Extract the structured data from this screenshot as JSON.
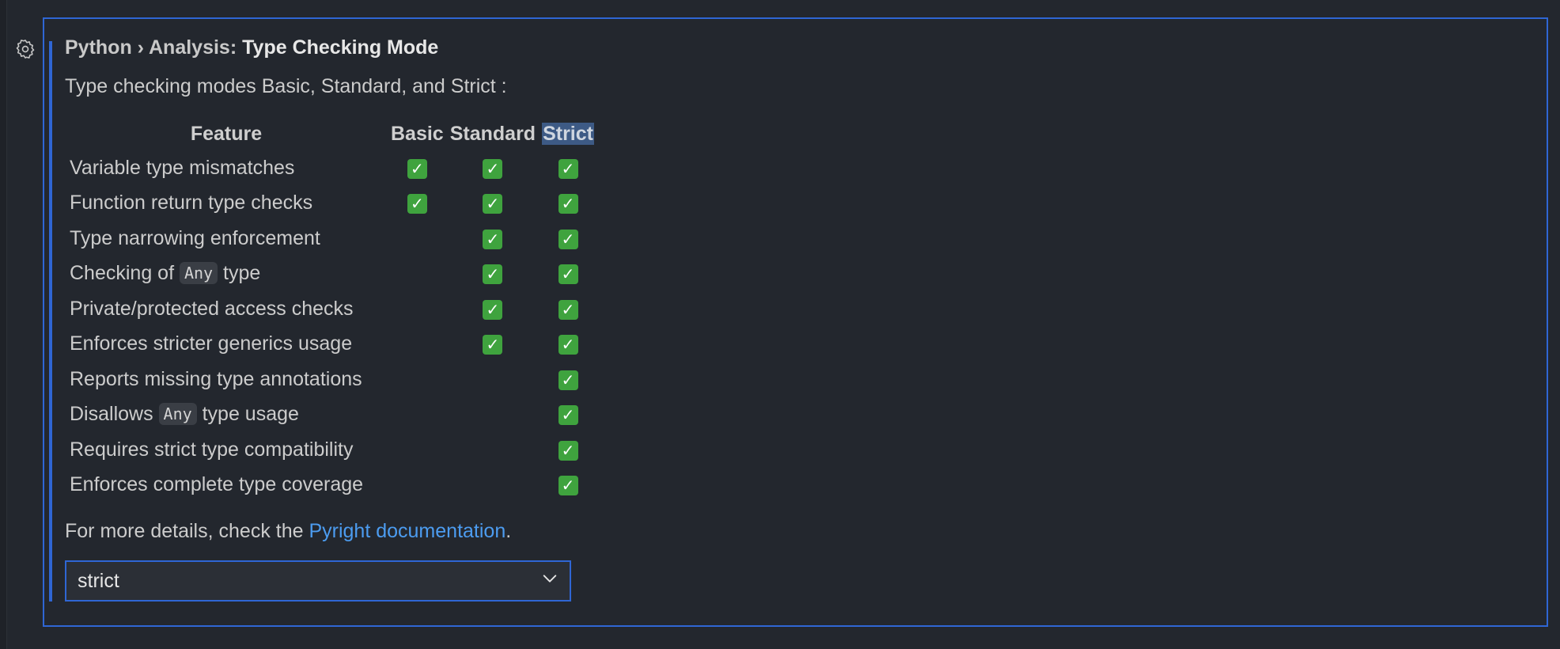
{
  "setting": {
    "category": "Python › Analysis:",
    "name": "Type Checking Mode",
    "description": "Type checking modes Basic, Standard, and Strict :"
  },
  "table": {
    "headers": [
      "Feature",
      "Basic",
      "Standard",
      "Strict"
    ],
    "rows": [
      {
        "pre": "Variable type mismatches",
        "basic": true,
        "standard": true,
        "strict": true
      },
      {
        "pre": "Function return type checks",
        "basic": true,
        "standard": true,
        "strict": true
      },
      {
        "pre": "Type narrowing enforcement",
        "basic": false,
        "standard": true,
        "strict": true
      },
      {
        "pre": "Checking of ",
        "code": "Any",
        "post": " type",
        "basic": false,
        "standard": true,
        "strict": true
      },
      {
        "pre": "Private/protected access checks",
        "basic": false,
        "standard": true,
        "strict": true
      },
      {
        "pre": "Enforces stricter generics usage",
        "basic": false,
        "standard": true,
        "strict": true
      },
      {
        "pre": "Reports missing type annotations",
        "basic": false,
        "standard": false,
        "strict": true
      },
      {
        "pre": "Disallows ",
        "code": "Any",
        "post": " type usage",
        "basic": false,
        "standard": false,
        "strict": true
      },
      {
        "pre": "Requires strict type compatibility",
        "basic": false,
        "standard": false,
        "strict": true
      },
      {
        "pre": "Enforces complete type coverage",
        "basic": false,
        "standard": false,
        "strict": true
      }
    ],
    "check_glyph": "✓"
  },
  "footer": {
    "prefix": "For more details, check the ",
    "link": "Pyright documentation",
    "suffix": "."
  },
  "select": {
    "value": "strict"
  },
  "colors": {
    "accent": "#2f66d4",
    "link": "#4c9cf0",
    "check": "#3fa33e"
  },
  "icons": {
    "settings": "gear-icon",
    "dropdown": "chevron-down-icon",
    "check": "check-mark-icon"
  }
}
